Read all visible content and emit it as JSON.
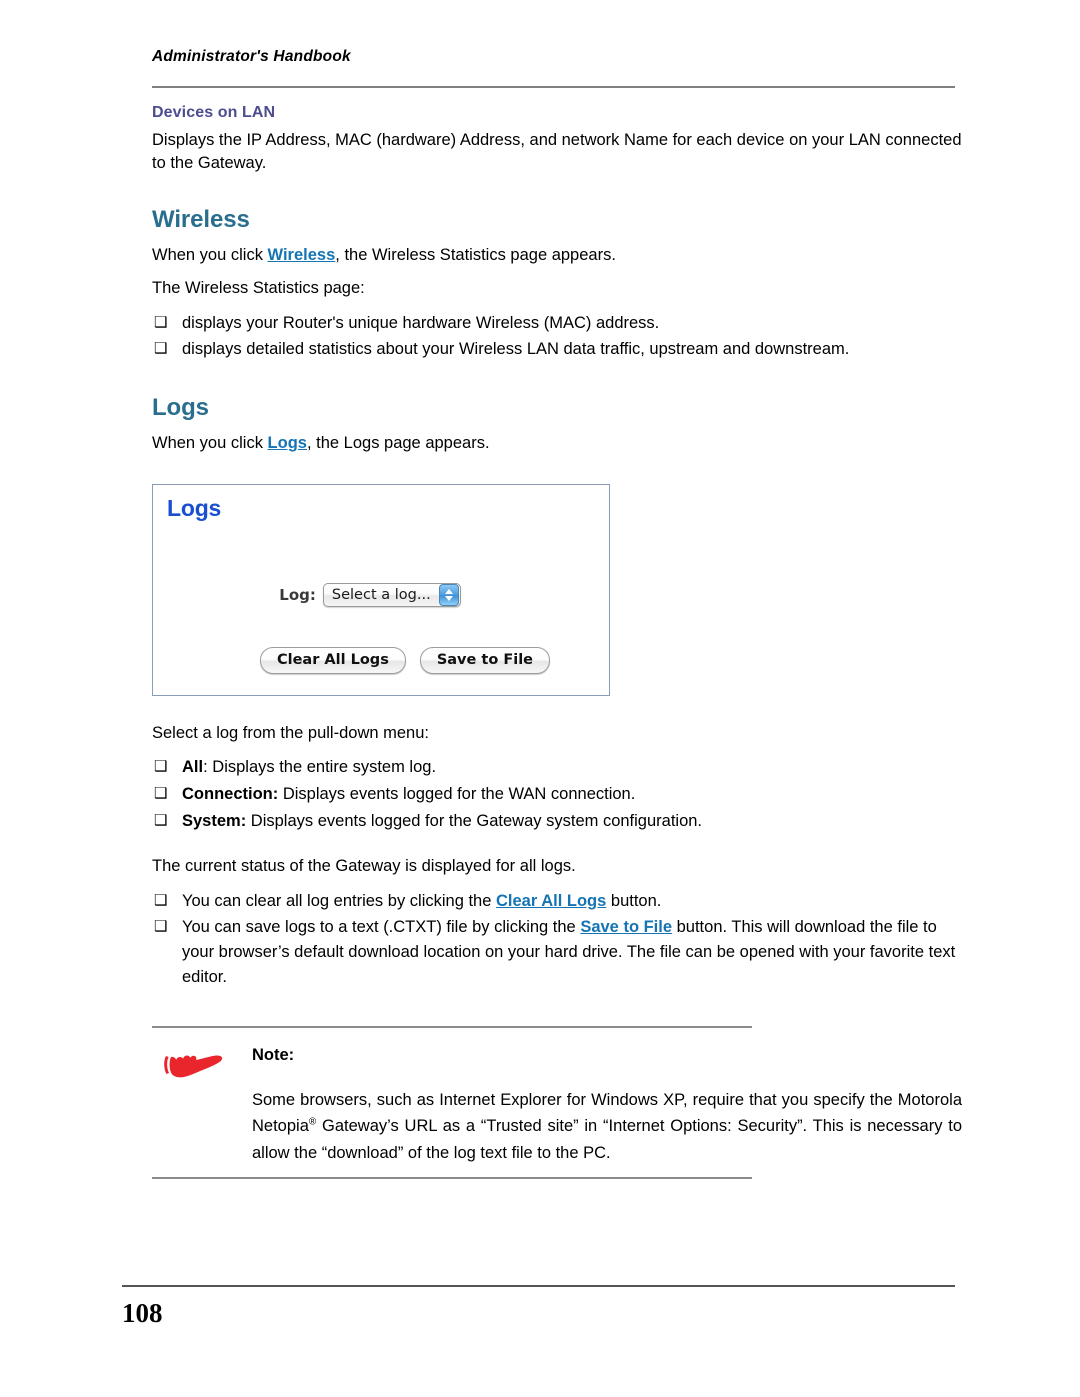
{
  "header": {
    "running_title": "Administrator's Handbook"
  },
  "sections": {
    "devices_on_lan": {
      "heading": "Devices on LAN",
      "paragraph": "Displays the IP Address, MAC (hardware) Address, and network Name for each device on your LAN connected to the Gateway."
    },
    "wireless": {
      "heading": "Wireless",
      "intro_prefix": "When you click ",
      "intro_link": "Wireless",
      "intro_suffix": ", the Wireless Statistics page appears.",
      "lead_in": "The Wireless Statistics page:",
      "bullets": [
        "displays your Router's unique hardware Wireless (MAC) address.",
        "displays detailed statistics about your Wireless LAN data traffic, upstream and downstream."
      ]
    },
    "logs": {
      "heading": "Logs",
      "intro_prefix": "When you click ",
      "intro_link": "Logs",
      "intro_suffix": ", the Logs page appears.",
      "figure": {
        "title": "Logs",
        "log_label": "Log:",
        "dropdown_value": "Select a log...",
        "clear_button": "Clear All Logs",
        "save_button": "Save to File"
      },
      "select_lead_in": "Select a log from the pull-down menu:",
      "log_options": [
        {
          "name": "All",
          "colon_outside": ":",
          "description": " Displays the entire system log."
        },
        {
          "name": "Connection:",
          "colon_outside": "",
          "description": " Displays events logged for the WAN connection."
        },
        {
          "name": "System:",
          "colon_outside": "",
          "description": " Displays events logged for the Gateway system configuration."
        }
      ],
      "status_line": "The current status of the Gateway is displayed for all logs.",
      "action_bullets": [
        {
          "prefix": "You can clear all log entries by clicking the ",
          "link": "Clear All Logs",
          "suffix": " button."
        },
        {
          "prefix": "You can save logs to a text (.CTXT) file by clicking the ",
          "link": "Save to File",
          "suffix": " button. This will download the file to your browser’s default download location on your hard drive. The file can be opened with your favorite text editor."
        }
      ]
    }
  },
  "note": {
    "icon": "pointing-hand-icon",
    "label": "Note:",
    "line1": "Some browsers, such as Internet Explorer for Windows XP, require that you specify the",
    "line2_prefix": "Motorola Netopia",
    "line2_sup": "®",
    "line2_suffix": " Gateway’s URL as a “Trusted site” in “Internet Options: Security”. This is necessary to allow the “download” of the log text file to the PC."
  },
  "footer": {
    "page_number": "108"
  },
  "colors": {
    "h1_teal": "#2a6e8d",
    "subhead_purple": "#4c4c8f",
    "link_blue": "#1474b4",
    "figure_title_blue": "#1a4fd0",
    "figure_border": "#8a9cb8",
    "note_hand_red": "#e8262c",
    "rule_gray": "#808080"
  }
}
